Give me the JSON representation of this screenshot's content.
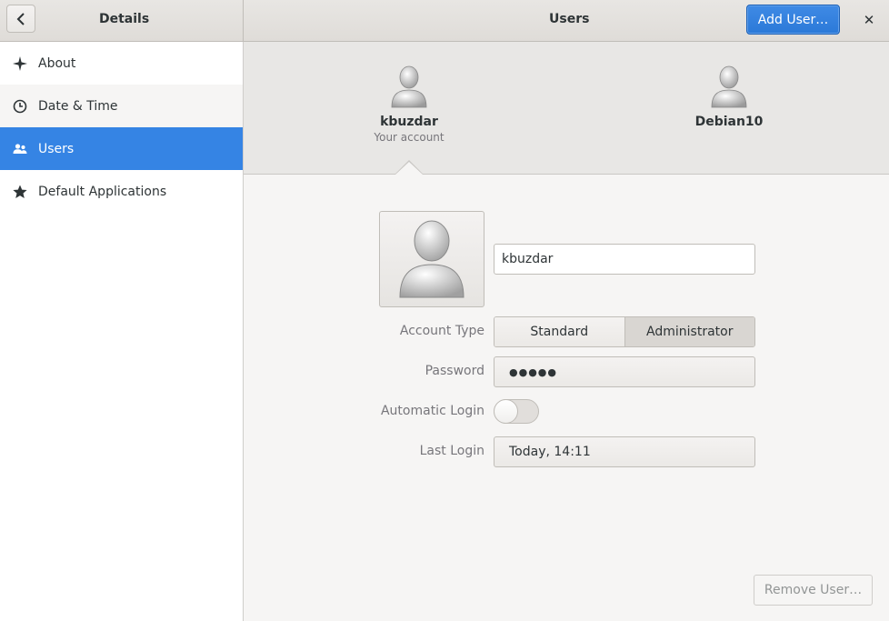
{
  "header": {
    "left_title": "Details",
    "title": "Users",
    "add_user_label": "Add User…",
    "close_glyph": "✕"
  },
  "sidebar": {
    "items": [
      {
        "label": "About",
        "icon": "sparkle-icon",
        "selected": false
      },
      {
        "label": "Date & Time",
        "icon": "clock-icon",
        "selected": false
      },
      {
        "label": "Users",
        "icon": "people-icon",
        "selected": true
      },
      {
        "label": "Default Applications",
        "icon": "star-icon",
        "selected": false
      }
    ]
  },
  "users": [
    {
      "name": "kbuzdar",
      "subtitle": "Your account"
    },
    {
      "name": "Debian10",
      "subtitle": ""
    }
  ],
  "detail": {
    "username": "kbuzdar",
    "account_type_label": "Account Type",
    "account_type_options": [
      "Standard",
      "Administrator"
    ],
    "account_type_selected": "Administrator",
    "password_label": "Password",
    "password_value": "●●●●●",
    "automatic_login_label": "Automatic Login",
    "automatic_login": false,
    "last_login_label": "Last Login",
    "last_login_value": "Today, 14:11",
    "remove_user_label": "Remove User…"
  },
  "colors": {
    "accent": "#3584e4",
    "button_blue": "#2b79d8"
  }
}
